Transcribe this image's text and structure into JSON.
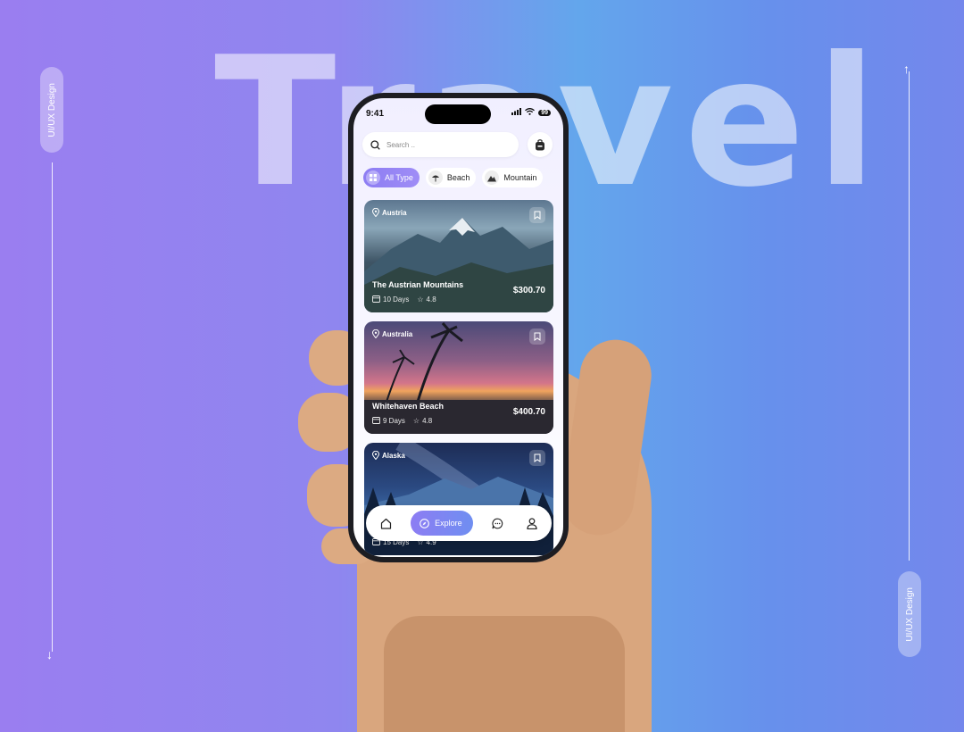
{
  "background": {
    "title": "Travel",
    "side_label_left": "UI/UX Design",
    "side_label_right": "UI/UX Design"
  },
  "status_bar": {
    "time": "9:41",
    "battery": "99"
  },
  "search": {
    "placeholder": "Search ..",
    "icon": "search-icon"
  },
  "header": {
    "bag_icon": "backpack-icon"
  },
  "categories": [
    {
      "label": "All Type",
      "icon": "grid-icon",
      "active": true
    },
    {
      "label": "Beach",
      "icon": "beach-icon",
      "active": false
    },
    {
      "label": "Mountain",
      "icon": "mountain-icon",
      "active": false
    }
  ],
  "destinations": [
    {
      "location": "Austria",
      "title": "The Austrian Mountains",
      "days": "10 Days",
      "rating": "4.8",
      "price": "$300.70"
    },
    {
      "location": "Australia",
      "title": "Whitehaven Beach",
      "days": "9 Days",
      "rating": "4.8",
      "price": "$400.70"
    },
    {
      "location": "Alaska",
      "title": "",
      "days": "15 Days",
      "rating": "4.9",
      "price": ""
    }
  ],
  "nav": {
    "home_icon": "home-icon",
    "explore_label": "Explore",
    "explore_icon": "compass-icon",
    "chat_icon": "chat-icon",
    "profile_icon": "profile-icon"
  },
  "colors": {
    "accent": "#8d7df3",
    "bg_left": "#9a7ef0",
    "bg_right": "#6790ec"
  }
}
